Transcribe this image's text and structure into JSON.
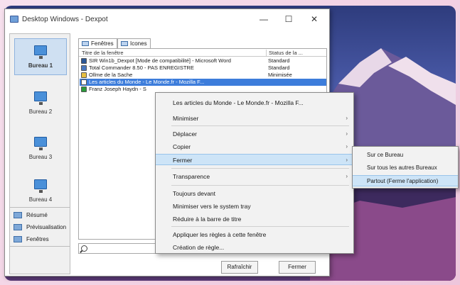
{
  "window": {
    "title": "Desktop Windows - Dexpot",
    "minimize": "—",
    "maximize": "☐",
    "close": "✕"
  },
  "desktops": [
    {
      "label": "Bureau 1",
      "selected": true
    },
    {
      "label": "Bureau 2",
      "selected": false
    },
    {
      "label": "Bureau 3",
      "selected": false
    },
    {
      "label": "Bureau 4",
      "selected": false
    }
  ],
  "left_actions": [
    {
      "label": "Résumé",
      "icon": "summary-icon"
    },
    {
      "label": "Prévisualisation",
      "icon": "preview-icon"
    },
    {
      "label": "Fenêtres",
      "icon": "windows-icon"
    }
  ],
  "tabs": [
    {
      "label": "Fenêtres",
      "active": true
    },
    {
      "label": "Icones",
      "active": false
    }
  ],
  "list": {
    "col_title": "Titre de la fenêtre",
    "col_status": "Status de la ...",
    "rows": [
      {
        "title": "SIR Win1b_Dexpot [Mode de compatibilité] - Microsoft Word",
        "status": "Standard",
        "icon_color": "#2b5797",
        "selected": false
      },
      {
        "title": "Total Commander 8.50 - PAS ENREGISTRE",
        "status": "Standard",
        "icon_color": "#4a78c0",
        "selected": false
      },
      {
        "title": "Ollme de la Sache",
        "status": "Minimisée",
        "icon_color": "#e8c040",
        "selected": false
      },
      {
        "title": "Les articles du Monde - Le Monde.fr - Mozilla F...",
        "status": "",
        "icon_color": "#ffffff",
        "selected": true
      },
      {
        "title": "Franz Joseph Haydn - S",
        "status": "",
        "icon_color": "#2a9a3a",
        "selected": false
      }
    ]
  },
  "buttons": {
    "refresh": "Rafraîchir",
    "close": "Fermer"
  },
  "context_menu": {
    "items": [
      {
        "label": "Les articles du Monde - Le Monde.fr - Mozilla F...",
        "arrow": false,
        "highlighted": false
      },
      {
        "label": "Minimiser",
        "arrow": true,
        "highlighted": false
      },
      {
        "label": "Déplacer",
        "arrow": true,
        "highlighted": false
      },
      {
        "label": "Copier",
        "arrow": true,
        "highlighted": false
      },
      {
        "label": "Fermer",
        "arrow": true,
        "highlighted": true
      },
      {
        "label": "Transparence",
        "arrow": true,
        "highlighted": false
      },
      {
        "label": "Toujours devant",
        "arrow": false,
        "highlighted": false
      },
      {
        "label": "Minimiser vers le system tray",
        "arrow": false,
        "highlighted": false
      },
      {
        "label": "Réduire à la barre de titre",
        "arrow": false,
        "highlighted": false
      },
      {
        "label": "Appliquer les règles à cette fenêtre",
        "arrow": false,
        "highlighted": false
      },
      {
        "label": "Création de règle...",
        "arrow": false,
        "highlighted": false
      }
    ],
    "arrow_glyph": "›"
  },
  "submenu": {
    "items": [
      {
        "label": "Sur ce Bureau",
        "highlighted": false
      },
      {
        "label": "Sur tous les autres Bureaux",
        "highlighted": false
      },
      {
        "label": "Partout (Ferme l'application)",
        "highlighted": true
      }
    ]
  },
  "colors": {
    "frame": "#f2d6e6",
    "selection": "#3d7ddb",
    "menu_highlight": "#cde4f7"
  }
}
